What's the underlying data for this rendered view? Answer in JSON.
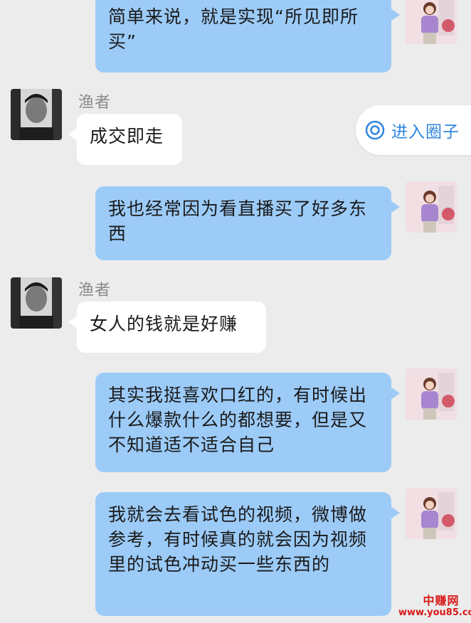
{
  "chat": {
    "messages": [
      {
        "side": "out",
        "text": "简单来说，就是实现“所见即所买”"
      },
      {
        "side": "in",
        "sender": "渔者",
        "text": "成交即走"
      },
      {
        "side": "out",
        "text": "我也经常因为看直播买了好多东西"
      },
      {
        "side": "in",
        "sender": "渔者",
        "text": "女人的钱就是好赚"
      },
      {
        "side": "out",
        "text": "其实我挺喜欢口红的，有时候出什么爆款什么的都想要，但是又不知道适不适合自己"
      },
      {
        "side": "out",
        "text": "我就会去看试色的视频，微博做参考，有时候真的就会因为视频里的试色冲动买一些东西的"
      }
    ]
  },
  "circle_button": {
    "label": "进入圈子",
    "icon": "circle-target-icon"
  },
  "watermark": {
    "line1": "中赚网",
    "line2": "www.you85.com"
  },
  "colors": {
    "background": "#ececec",
    "outgoing_bubble": "#9ccbf7",
    "incoming_bubble": "#ffffff",
    "link": "#2f86e0",
    "watermark": "#d81818"
  }
}
